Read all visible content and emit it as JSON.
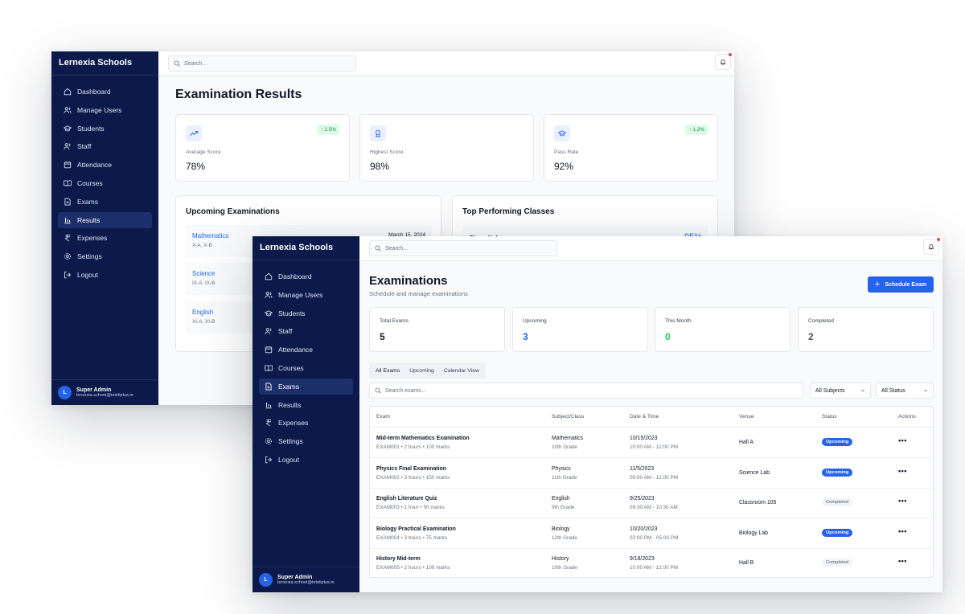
{
  "back": {
    "brand": "Lernexia Schools",
    "search_placeholder": "Search...",
    "nav": [
      "Dashboard",
      "Manage Users",
      "Students",
      "Staff",
      "Attendance",
      "Courses",
      "Exams",
      "Results",
      "Expenses",
      "Settings",
      "Logout"
    ],
    "active_nav": "Results",
    "user": {
      "initial": "L",
      "name": "Super Admin",
      "email": "lernexia.school@inteliplus.in"
    },
    "title": "Examination Results",
    "stats": [
      {
        "label": "Average Score",
        "value": "78%",
        "badge": "↑ 2.5%",
        "icon": "trending-up-icon"
      },
      {
        "label": "Highest Score",
        "value": "98%",
        "badge": "",
        "icon": "award-icon"
      },
      {
        "label": "Pass Rate",
        "value": "92%",
        "badge": "↑ 1.2%",
        "icon": "graduation-cap-icon"
      }
    ],
    "upcoming_title": "Upcoming Examinations",
    "upcoming": [
      {
        "subject": "Mathematics",
        "classes": "X-A, X-B",
        "date": "March 15, 2024"
      },
      {
        "subject": "Science",
        "classes": "IX-A, IX-B",
        "date": ""
      },
      {
        "subject": "English",
        "classes": "XI-A, XI-B",
        "date": ""
      }
    ],
    "top_title": "Top Performing Classes",
    "top": [
      {
        "class": "Class X-A",
        "pct": "95%"
      }
    ]
  },
  "front": {
    "brand": "Lernexia Schools",
    "search_placeholder": "Search...",
    "nav": [
      "Dashboard",
      "Manage Users",
      "Students",
      "Staff",
      "Attendance",
      "Courses",
      "Exams",
      "Results",
      "Expenses",
      "Settings",
      "Logout"
    ],
    "active_nav": "Exams",
    "user": {
      "initial": "L",
      "name": "Super Admin",
      "email": "lernexia.school@inteliplus.in"
    },
    "title": "Examinations",
    "subtitle": "Schedule and manage examinations",
    "schedule_button": "Schedule Exam",
    "cards": [
      {
        "label": "Total Exams",
        "value": "5",
        "color": "#111827"
      },
      {
        "label": "Upcoming",
        "value": "3",
        "color": "#2563eb"
      },
      {
        "label": "This Month",
        "value": "0",
        "color": "#22c55e"
      },
      {
        "label": "Completed",
        "value": "2",
        "color": "#475569"
      }
    ],
    "tabs": [
      "All Exams",
      "Upcoming",
      "Calendar View"
    ],
    "exam_search_placeholder": "Search exams...",
    "subject_filter": "All Subjects",
    "status_filter": "All Status",
    "columns": [
      "Exam",
      "Subject/Class",
      "Date & Time",
      "Venue",
      "Status",
      "Actions"
    ],
    "rows": [
      {
        "name": "Mid-term Mathematics Examination",
        "meta": "EXAM001 • 2 hours • 100 marks",
        "subject": "Mathematics",
        "grade": "10th Grade",
        "date": "10/15/2023",
        "time": "10:00 AM - 12:00 PM",
        "venue": "Hall A",
        "status": "Upcoming"
      },
      {
        "name": "Physics Final Examination",
        "meta": "EXAM002 • 3 hours • 150 marks",
        "subject": "Physics",
        "grade": "11th Grade",
        "date": "11/5/2023",
        "time": "09:00 AM - 12:00 PM",
        "venue": "Science Lab",
        "status": "Upcoming"
      },
      {
        "name": "English Literature Quiz",
        "meta": "EXAM003 • 1 hour • 50 marks",
        "subject": "English",
        "grade": "9th Grade",
        "date": "9/25/2023",
        "time": "09:30 AM - 10:30 AM",
        "venue": "Classroom 105",
        "status": "Completed"
      },
      {
        "name": "Biology Practical Examination",
        "meta": "EXAM004 • 3 hours • 75 marks",
        "subject": "Biology",
        "grade": "12th Grade",
        "date": "10/20/2023",
        "time": "02:00 PM - 05:00 PM",
        "venue": "Biology Lab",
        "status": "Upcoming"
      },
      {
        "name": "History Mid-term",
        "meta": "EXAM005 • 2 hours • 100 marks",
        "subject": "History",
        "grade": "10th Grade",
        "date": "9/18/2023",
        "time": "10:00 AM - 12:00 PM",
        "venue": "Hall B",
        "status": "Completed"
      }
    ],
    "actions_glyph": "•••"
  }
}
